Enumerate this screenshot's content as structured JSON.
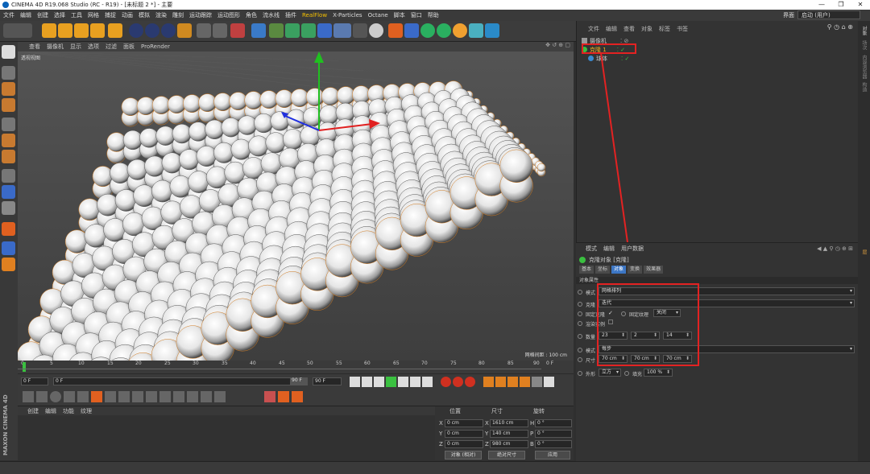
{
  "window": {
    "title": "CINEMA 4D R19.068 Studio (RC - R19) - [未标题 2 *] - 主要"
  },
  "menubar": {
    "items": [
      "文件",
      "编辑",
      "创建",
      "选择",
      "工具",
      "网格",
      "捕捉",
      "动画",
      "模拟",
      "渲染",
      "雕刻",
      "运动跟踪",
      "运动图形",
      "角色",
      "流水线",
      "插件",
      "RealFlow",
      "X-Particles",
      "Octane",
      "脚本",
      "窗口",
      "帮助"
    ],
    "layout_label": "界面",
    "layout_value": "启动 (用户)"
  },
  "viewport": {
    "menu": [
      "查看",
      "摄像机",
      "显示",
      "选项",
      "过滤",
      "面板",
      "ProRender"
    ],
    "camera_label": "透视视图",
    "grid_spacing": "网格间距 : 100 cm"
  },
  "timeline": {
    "ticks": [
      "0",
      "5",
      "10",
      "15",
      "20",
      "25",
      "30",
      "35",
      "40",
      "45",
      "50",
      "55",
      "60",
      "65",
      "70",
      "75",
      "80",
      "85",
      "90"
    ],
    "end_marker": "0 F",
    "current_frame": "0 F",
    "start_frame": "0 F",
    "end_frame": "90 F",
    "max_frame": "90 F"
  },
  "material_panel": {
    "menu": [
      "创建",
      "编辑",
      "功能",
      "纹理"
    ],
    "brand": "MAXON CINEMA 4D"
  },
  "coord_panel": {
    "headers": [
      "位置",
      "尺寸",
      "旋转"
    ],
    "rows": [
      {
        "axis": "X",
        "pos": "0 cm",
        "size_axis": "X",
        "size": "1610 cm",
        "rot_axis": "H",
        "rot": "0 °"
      },
      {
        "axis": "Y",
        "pos": "0 cm",
        "size_axis": "Y",
        "size": "140 cm",
        "rot_axis": "P",
        "rot": "0 °"
      },
      {
        "axis": "Z",
        "pos": "0 cm",
        "size_axis": "Z",
        "size": "980 cm",
        "rot_axis": "B",
        "rot": "0 °"
      }
    ],
    "mode_dropdown": "对象 (相对)",
    "size_dropdown": "绝对尺寸",
    "apply_button": "应用"
  },
  "object_manager": {
    "menu": [
      "文件",
      "编辑",
      "查看",
      "对象",
      "标签",
      "书签"
    ],
    "objects": [
      {
        "name": "摄像机",
        "level": 0
      },
      {
        "name": "克隆 1",
        "level": 0
      },
      {
        "name": "球体",
        "level": 1
      }
    ]
  },
  "side_tabs": [
    "对象",
    "场次",
    "内容浏览器",
    "构造",
    "层"
  ],
  "attributes": {
    "menu": [
      "模式",
      "编辑",
      "用户数据"
    ],
    "object_title": "克隆对象 [克隆]",
    "tabs": [
      "基本",
      "坐标",
      "对象",
      "变换",
      "效果器"
    ],
    "active_tab": "对象",
    "section": "对象属性",
    "mode_label": "模式",
    "mode_value": "网格排列",
    "clone_label": "克隆",
    "clone_value": "迭代",
    "fix_clone_label": "固定克隆",
    "fix_texture_label": "固定纹理",
    "fix_texture_value": "关闭",
    "render_instance_label": "渲染实例",
    "count_label": "数量",
    "count_values": [
      "23",
      "2",
      "14"
    ],
    "mode2_label": "模式",
    "mode2_value": "每步",
    "size_label": "尺寸",
    "size_values": [
      "70 cm",
      "70 cm",
      "70 cm"
    ],
    "shape_label": "外形",
    "shape_value": "立方",
    "fill_label": "填充",
    "fill_value": "100 %"
  }
}
